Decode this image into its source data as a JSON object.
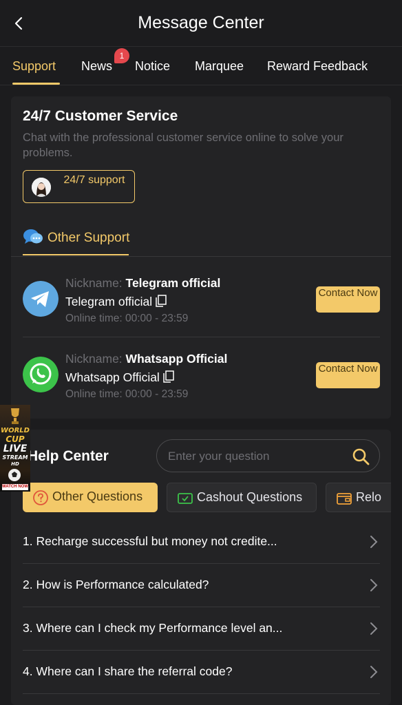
{
  "header": {
    "title": "Message Center"
  },
  "tabs": [
    {
      "label": "Support",
      "active": true
    },
    {
      "label": "News",
      "badge": "1"
    },
    {
      "label": "Notice"
    },
    {
      "label": "Marquee"
    },
    {
      "label": "Reward Feedback"
    }
  ],
  "customer_service": {
    "title": "24/7 Customer Service",
    "description": "Chat with the professional customer service online to solve your problems.",
    "button_label": "24/7 support"
  },
  "other_support": {
    "label": "Other Support",
    "contacts": [
      {
        "nickname_label": "Nickname:",
        "nickname": "Telegram official",
        "name": "Telegram official",
        "online_time": "Online time: 00:00 - 23:59",
        "button": "Contact Now",
        "icon": "telegram-icon"
      },
      {
        "nickname_label": "Nickname:",
        "nickname": "Whatsapp Official",
        "name": "Whatsapp Official",
        "online_time": "Online time: 00:00 - 23:59",
        "button": "Contact Now",
        "icon": "whatsapp-icon"
      }
    ]
  },
  "help_center": {
    "title": "Help Center",
    "search_placeholder": "Enter your question",
    "categories": [
      {
        "label": "Other Questions",
        "active": true
      },
      {
        "label": "Cashout Questions"
      },
      {
        "label": "Relo"
      }
    ],
    "questions": [
      "1. Recharge successful but money not credite...",
      "2. How is Performance calculated?",
      "3. Where can I check my Performance level an...",
      "4. Where can I share the referral code?"
    ]
  },
  "ad_banner": {
    "line1": "WORLD",
    "line2": "CUP",
    "line3": "LIVE",
    "line4": "STREAM",
    "line5": "HD",
    "cta": "WATCH NOW"
  },
  "colors": {
    "accent": "#f3c969",
    "background": "#1c1c1e",
    "card": "#232325",
    "badge": "#e5484d"
  }
}
